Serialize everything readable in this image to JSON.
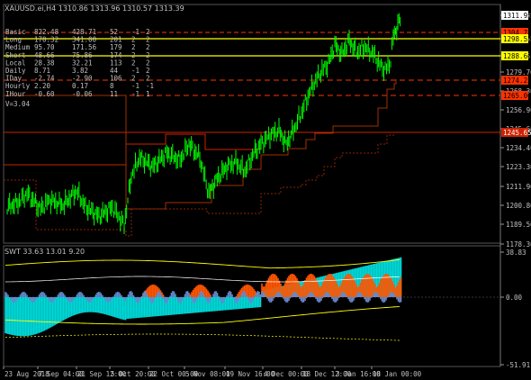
{
  "header": {
    "symbol_info": "XAUUSD.ei,H4  1310.86 1313.96 1310.57 1313.39"
  },
  "stats": {
    "rows": [
      [
        "Basic",
        "822.48",
        "428.71",
        "52",
        "-1",
        "2"
      ],
      [
        "Long",
        "170.32",
        "341.00",
        "201",
        "2",
        "2"
      ],
      [
        "Medium",
        "95.70",
        "171.56",
        "179",
        "2",
        "2"
      ],
      [
        "Short",
        "48.66",
        "75.86",
        "174",
        "2",
        "2"
      ],
      [
        "Local",
        "28.38",
        "32.21",
        "113",
        "2",
        "2"
      ],
      [
        "Daily",
        "8.71",
        "3.82",
        "44",
        "-1",
        "2"
      ],
      [
        "IDay",
        "-2.74",
        "-2.90",
        "106",
        "2",
        "2"
      ],
      [
        "Hourly",
        "2.20",
        "0.17",
        "8",
        "-1",
        "-1"
      ],
      [
        "IHour",
        "-0.60",
        "-0.06",
        "11",
        "-1",
        "1"
      ]
    ],
    "version": "V=3.04"
  },
  "price_axis": {
    "ticks": [
      "1311.95",
      "1298.55",
      "1288.60",
      "1279.70",
      "1268.30",
      "1256.90",
      "1245.60",
      "1234.40",
      "1223.30",
      "1211.90",
      "1200.80",
      "1189.50",
      "1178.30"
    ],
    "badges": [
      {
        "label": "1311.95",
        "bg": "#ffffff",
        "fg": "#000000"
      },
      {
        "label": "1304.78",
        "bg": "#ff3300",
        "fg": "#000000"
      },
      {
        "label": "1298.55",
        "bg": "#ffff00",
        "fg": "#000000"
      },
      {
        "label": "1288.60",
        "bg": "#ffff00",
        "fg": "#000000"
      },
      {
        "label": "1274.25",
        "bg": "#ff3300",
        "fg": "#000000"
      },
      {
        "label": "1265.00",
        "bg": "#ff3300",
        "fg": "#000000"
      },
      {
        "label": "1245.65",
        "bg": "#cc2200",
        "fg": "#ffffff"
      }
    ]
  },
  "indicator": {
    "title": "SWT 33.63 13.01 9.20",
    "axis_labels": [
      "38.83",
      "0.00",
      "-51.91"
    ]
  },
  "time_axis": {
    "labels": [
      "23 Aug 2018",
      "7 Sep 04:00",
      "21 Sep 12:00",
      "5 Oct 20:00",
      "22 Oct 00:00",
      "5 Nov 08:00",
      "19 Nov 16:00",
      "4 Dec 00:00",
      "18 Dec 12:00",
      "3 Jan 16:00",
      "18 Jan 00:00"
    ]
  },
  "colors": {
    "background": "#000000",
    "candles": "#00ff00",
    "level_yellow": "#ffff00",
    "level_red": "#ff3300",
    "level_brown": "#8b2500",
    "histogram_cyan": "#00d8d8",
    "histogram_orange": "#ff5500",
    "histogram_blue": "#6688cc",
    "text": "#c0c0c0"
  }
}
